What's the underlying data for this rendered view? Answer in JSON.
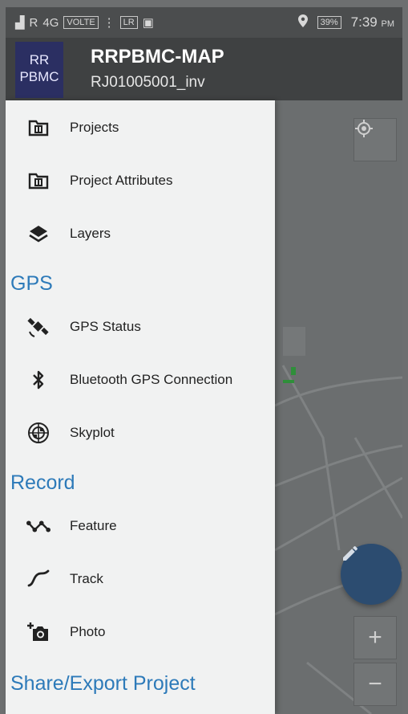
{
  "status_bar": {
    "left_indicators": [
      "R",
      "4G",
      "VOLTE",
      "⋮",
      "LR"
    ],
    "battery": "39%",
    "time": "7:39",
    "ampm": "PM"
  },
  "app_bar": {
    "logo_line1": "RR",
    "logo_line2": "PBMC",
    "title": "RRPBMC-MAP",
    "subtitle": "RJ01005001_inv"
  },
  "drawer": {
    "items_top": [
      {
        "label": "Projects",
        "icon": "folder-icon"
      },
      {
        "label": "Project Attributes",
        "icon": "folder-icon"
      },
      {
        "label": "Layers",
        "icon": "layers-icon"
      }
    ],
    "sections": [
      {
        "title": "GPS",
        "items": [
          {
            "label": "GPS Status",
            "icon": "satellite-icon"
          },
          {
            "label": "Bluetooth GPS Connection",
            "icon": "bluetooth-icon"
          },
          {
            "label": "Skyplot",
            "icon": "skyplot-icon"
          }
        ]
      },
      {
        "title": "Record",
        "items": [
          {
            "label": "Feature",
            "icon": "polyline-icon"
          },
          {
            "label": "Track",
            "icon": "track-icon"
          },
          {
            "label": "Photo",
            "icon": "add-photo-icon"
          }
        ]
      },
      {
        "title": "Share/Export Project",
        "items": []
      }
    ]
  },
  "map_controls": {
    "zoom_in": "+",
    "zoom_out": "−"
  },
  "colors": {
    "drawer_bg": "#f1f2f2",
    "section_title": "#2d7ab9",
    "app_bar": "#3f4142",
    "logo_bg": "#2b2f62",
    "fab": "#2c4c70",
    "map_bg": "#6b6e6f"
  }
}
